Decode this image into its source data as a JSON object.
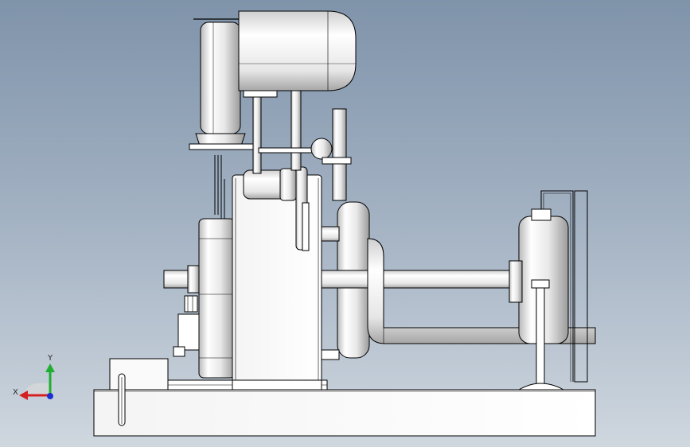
{
  "viewport": {
    "background_top": "#7f93aa",
    "background_bottom": "#cfd7df"
  },
  "triad": {
    "x_label": "X",
    "y_label": "Y",
    "x_color": "#d42020",
    "y_color": "#1fae2f",
    "z_color": "#1c2fd0"
  },
  "model": {
    "line_color": "#000000",
    "fill_color": "#ffffff"
  }
}
